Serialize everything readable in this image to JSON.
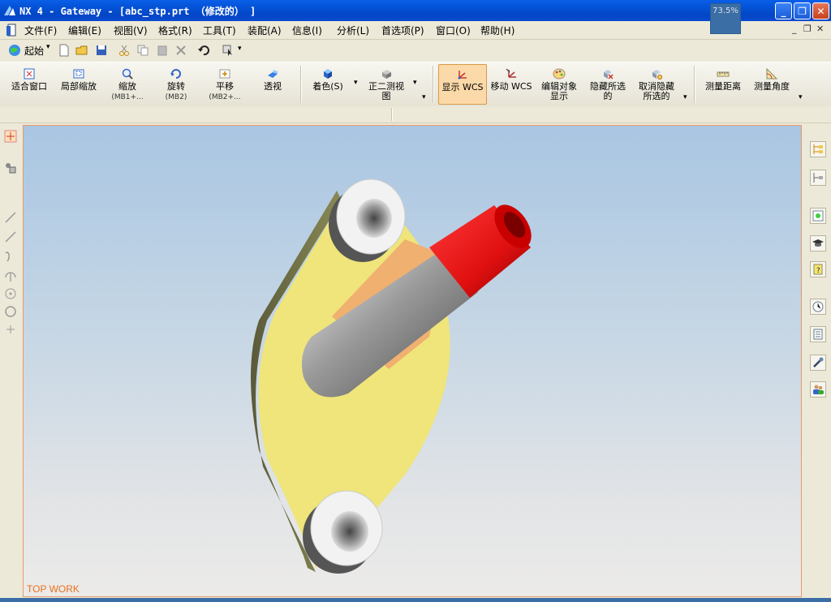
{
  "window": {
    "title": "NX 4 - Gateway - [abc_stp.prt （修改的） ]",
    "percent": "73.5%",
    "min": "_",
    "max": "❐",
    "close": "✕"
  },
  "menu": [
    "文件(F)",
    "编辑(E)",
    "视图(V)",
    "格式(R)",
    "工具(T)",
    "装配(A)",
    "信息(I)",
    "分析(L)",
    "首选项(P)",
    "窗口(O)",
    "帮助(H)"
  ],
  "mdi": {
    "min": "_",
    "restore": "❐",
    "close": "✕"
  },
  "toolbar1": {
    "start_label": "起始"
  },
  "toolbar2": [
    {
      "label": "适合窗口",
      "sub": ""
    },
    {
      "label": "局部缩放",
      "sub": ""
    },
    {
      "label": "缩放",
      "sub": "(MB1+..."
    },
    {
      "label": "旋转",
      "sub": "(MB2)"
    },
    {
      "label": "平移",
      "sub": "(MB2+..."
    },
    {
      "label": "透视",
      "sub": ""
    },
    {
      "label": "着色(S)",
      "sub": ""
    },
    {
      "label": "正二测视",
      "sub": "图"
    },
    {
      "label": "显示 WCS",
      "sub": ""
    },
    {
      "label": "移动 WCS",
      "sub": ""
    },
    {
      "label": "编辑对象",
      "sub": "显示"
    },
    {
      "label": "隐藏所选",
      "sub": "的"
    },
    {
      "label": "取消隐藏",
      "sub": "所选的"
    },
    {
      "label": "测量距离",
      "sub": ""
    },
    {
      "label": "测量角度",
      "sub": ""
    }
  ],
  "viewport": {
    "label": "TOP WORK"
  },
  "colors": {
    "titlebar": "#0454d8",
    "accent_active": "#fbd9a8",
    "part_face": "#efe57a",
    "pipe_red": "#e81818",
    "view_label": "#e8701c"
  }
}
